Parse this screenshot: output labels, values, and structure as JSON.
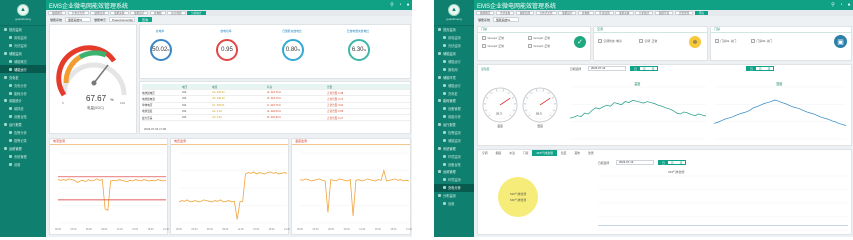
{
  "left": {
    "logo_text": "guanlimeng",
    "title": "EMS企业微电网能效管理系统",
    "tabs": [
      "储能概况",
      "分布式光伏",
      "储能监测",
      "储能系统",
      "储能运行",
      "充电桩",
      "综合能效",
      "分析统计"
    ],
    "active_tab_index": 7,
    "sidebar": [
      "首页监测",
      "用电监测",
      "光伏监测",
      "储能监测",
      "储能概况",
      "储能运行",
      "充电桩",
      "充电分析",
      "能耗分析",
      "用能统计",
      "碳排放",
      "设备台账",
      "运行报表",
      "告警分析",
      "报警记录",
      "运维管理",
      "系统管理",
      "设置"
    ],
    "active_sidebar_index": 5,
    "filter": {
      "label1": "储能系统",
      "value1": "储能系统#1",
      "label2": "储能单元",
      "value2": "PowerConvert(k)",
      "button": "查询"
    },
    "gauge": {
      "value": "67.67",
      "unit": "%",
      "label": "电量(SOC)",
      "min": "0",
      "max": "100"
    },
    "metrics": [
      {
        "label": "充电率",
        "value": "50.02",
        "unit": "%"
      },
      {
        "label": "放电功率",
        "value": "0.95",
        "unit": ""
      },
      {
        "label": "日储能充放电比",
        "value": "0.80",
        "unit": "%"
      },
      {
        "label": "日放电量充放电比",
        "value": "6.30",
        "unit": "%"
      }
    ],
    "table": {
      "headers": [
        "",
        "电压",
        "电流",
        "有功",
        "告警"
      ],
      "rows": [
        [
          "电池组电压",
          "V/A",
          "Ua: 406.61",
          "Ia: 424.70 A",
          "正常告警 2.38"
        ],
        [
          "电池组电流",
          "V/A",
          "Ub: 406.62",
          "Ib: 424.70 A",
          "正常告警 3.74"
        ],
        [
          "单体电压",
          "V/A",
          "Uc: 406.61",
          "Ic: 424.70 A",
          "正常告警 4.02"
        ],
        [
          "电池温度",
          "V/A",
          "Ua: 0.04",
          "Ia: 422.00 A",
          "正常告警 2.68"
        ],
        [
          "最大压差",
          "V/A",
          "Ub: 0.92",
          "Ib: 432.30 A",
          "正常告警 2.17"
        ]
      ],
      "timestamp": "2023-07-04 17:06"
    },
    "charts": [
      {
        "title": "电流监测",
        "values": [
          62,
          61,
          62,
          61,
          63,
          62,
          61,
          58,
          60,
          61,
          59,
          62,
          60,
          61,
          63,
          61,
          62,
          20,
          18,
          60,
          61,
          60,
          62,
          61,
          60,
          59,
          61,
          60,
          62,
          61,
          60,
          62,
          61,
          60,
          61,
          60,
          62,
          61,
          60,
          61
        ],
        "ylim": [
          0,
          100
        ],
        "marker_lines": [
          66,
          33
        ]
      },
      {
        "title": "电压监测",
        "values": [
          30,
          32,
          31,
          33,
          30,
          31,
          32,
          30,
          31,
          33,
          32,
          31,
          30,
          32,
          31,
          33,
          30,
          31,
          32,
          30,
          31,
          5,
          30,
          31,
          70,
          72,
          71,
          73,
          70,
          72,
          71,
          70,
          72,
          73,
          71,
          72,
          70,
          71,
          72,
          71
        ],
        "ylim": [
          0,
          100
        ]
      },
      {
        "title": "温度监测",
        "values": [
          62,
          61,
          63,
          62,
          60,
          61,
          62,
          63,
          61,
          60,
          15,
          62,
          61,
          60,
          63,
          62,
          61,
          60,
          62,
          10,
          61,
          62,
          60,
          61,
          63,
          62,
          61,
          60,
          62,
          61,
          75,
          60,
          61,
          62,
          63,
          61,
          62,
          60,
          61,
          60
        ],
        "ylim": [
          0,
          100
        ]
      }
    ],
    "x_ticks": [
      "00:00",
      "03:00",
      "06:00",
      "09:00",
      "12:00",
      "15:00",
      "18:00",
      "21:00"
    ]
  },
  "right": {
    "logo_text": "guanlimeng",
    "title": "EMS企业微电网能效管理系统",
    "tabs": [
      "储能概况",
      "光伏发电",
      "储能监测",
      "分布式光伏",
      "储能运行",
      "充电桩",
      "环境监测",
      "储能系统",
      "分析统计",
      "储能环境",
      "告警管理",
      "环境"
    ],
    "active_tab_index": 11,
    "sidebar": [
      "首页监测",
      "用电监测",
      "光伏监测",
      "储能监测",
      "储能运行",
      "微电网",
      "储能环境",
      "储能运行",
      "充电桩",
      "能耗管理",
      "设备管理",
      "用能分析",
      "运行报表",
      "告警监测",
      "储能监测",
      "系统管理",
      "环境监测",
      "设备台账",
      "运维管理",
      "环境监测",
      "充电分析",
      "分布监测",
      "设置"
    ],
    "active_sidebar_index": 20,
    "filter": {
      "label": "储能系统",
      "value": "储能系统#1"
    },
    "door_panel": {
      "title": "门禁",
      "items": [
        [
          "Group1: 正常",
          "Group2: 正常"
        ],
        [
          "Group3: 正常",
          "Group4: 正常"
        ]
      ]
    },
    "air_panel": {
      "title": "空调",
      "items": [
        "空调状态: 制冷",
        "空调: 正常"
      ]
    },
    "ac_panel": {
      "title": "门禁",
      "items": [
        "门禁#1: 关门",
        "门禁#2: 关门"
      ]
    },
    "env_header": {
      "label": "温湿度",
      "date_label": "日期选择",
      "date_value": "2023-07-14",
      "seg": [
        "日",
        "月",
        "年"
      ]
    },
    "temp_chart": {
      "title": "温度",
      "values": [
        40,
        42,
        45,
        43,
        50,
        48,
        55,
        60,
        58,
        62,
        65,
        63,
        70,
        68,
        66,
        72,
        70,
        74,
        73,
        71,
        69,
        72,
        70,
        68,
        65,
        63,
        60,
        58,
        55,
        50,
        48,
        52,
        50,
        47,
        45,
        48,
        46,
        44
      ]
    },
    "hum_chart": {
      "title": "湿度",
      "values": [
        30,
        32,
        35,
        38,
        40,
        42,
        45,
        48,
        50,
        52,
        55,
        60,
        62,
        65,
        68,
        70,
        72,
        75,
        73,
        70,
        68,
        65,
        62,
        60,
        58,
        55,
        52,
        50,
        48,
        45,
        42,
        40,
        38,
        35,
        33,
        30,
        28,
        26
      ]
    },
    "temp_gauge": {
      "label": "温度",
      "value": "26.3"
    },
    "hum_gauge": {
      "label": "湿度",
      "value": "56.5"
    },
    "bottom_tabs": [
      "空调",
      "烟感",
      "水浸",
      "门禁",
      "SF6气体监测",
      "温度",
      "其他",
      "监测"
    ],
    "bottom_active_index": 4,
    "bottom_date_label": "日期选择",
    "bottom_date_value": "2023-07-13",
    "bottom_seg": [
      "日",
      "月",
      "年"
    ],
    "sf6_label": "SF6气体监测",
    "sf6_items": [
      "SF6气体监测",
      "SF6气体监测"
    ],
    "sf6_chart": {
      "values": [
        8,
        8,
        8,
        8,
        8,
        8,
        8,
        8,
        8,
        8,
        8,
        8,
        8,
        8,
        8,
        8,
        8,
        8,
        8,
        8,
        8,
        8,
        8,
        8,
        8,
        8,
        8,
        8,
        8,
        8
      ]
    }
  },
  "colors": {
    "brand": "#10a084",
    "sidebar": "#0f7f6f",
    "orange_line": "#f0a43a",
    "red_line": "#d92b2b",
    "teal_line": "#1b9b83"
  }
}
